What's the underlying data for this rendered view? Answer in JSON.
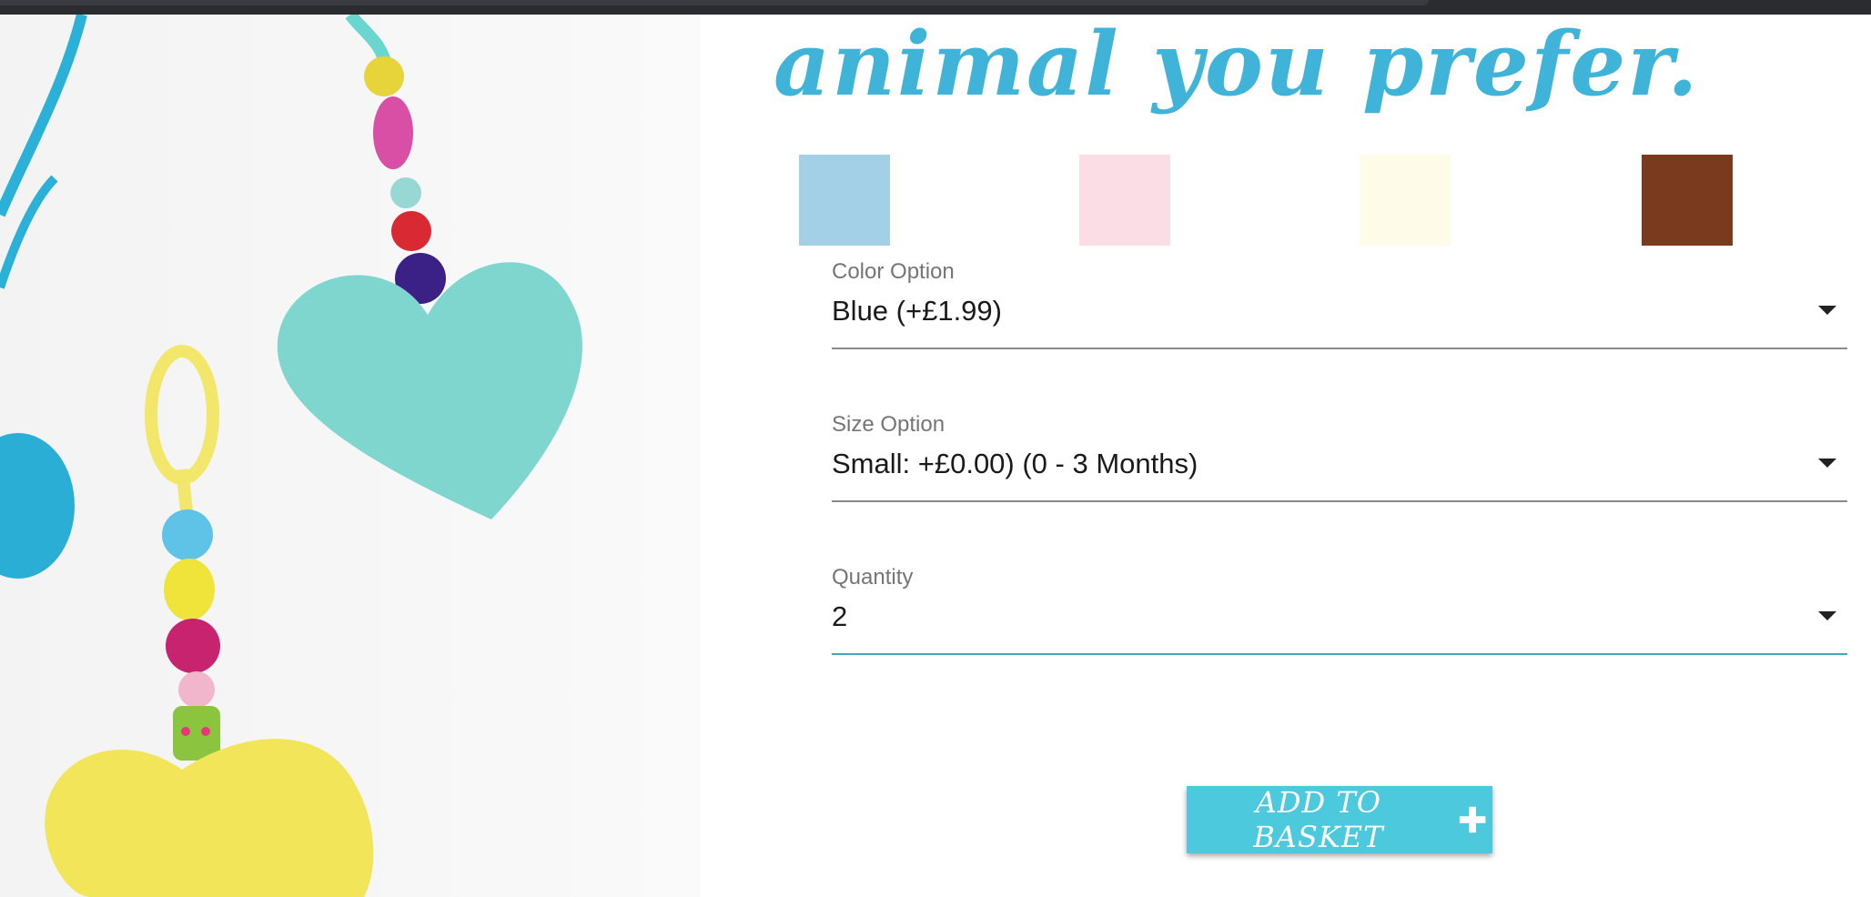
{
  "heading": "animal you prefer.",
  "swatches": {
    "blue": "#a3d0e6",
    "pink": "#fbdde6",
    "cream": "#fffbe9",
    "brown": "#7a3a1d"
  },
  "form": {
    "color": {
      "label": "Color Option",
      "value": "Blue (+£1.99)"
    },
    "size": {
      "label": "Size Option",
      "value": "Small: +£0.00) (0 - 3 Months)"
    },
    "quantity": {
      "label": "Quantity",
      "value": "2"
    }
  },
  "add_to_basket": {
    "label": "ADD TO BASKET",
    "icon": "plus-icon"
  },
  "colors": {
    "accent": "#3fb4d8",
    "button": "#4cc9dd"
  }
}
